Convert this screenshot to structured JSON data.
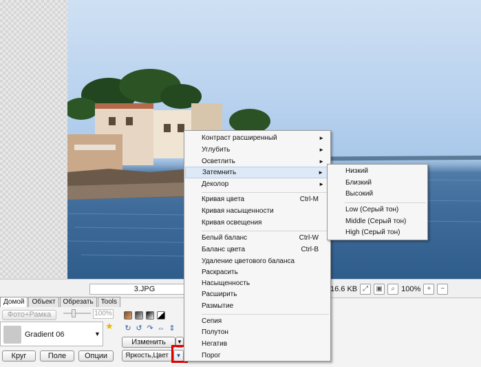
{
  "image": {
    "filename": "3.JPG"
  },
  "status": {
    "file_size": "16.6 KB",
    "zoom": "100%"
  },
  "tabs": [
    {
      "label": "Домой"
    },
    {
      "label": "Объект"
    },
    {
      "label": "Обрезать"
    },
    {
      "label": "Tools"
    }
  ],
  "toolbar": {
    "photo_frame_label": "Фото+Рамка",
    "opacity": "100%",
    "gradient_name": "Gradient 06",
    "circle_label": "Круг",
    "field_label": "Поле",
    "options_label": "Опции",
    "change_label": "Изменить",
    "brightness_label": "Яркость,Цвет"
  },
  "menu": {
    "items": [
      {
        "label": "Контраст расширенный",
        "submenu": true
      },
      {
        "label": "Углубить",
        "submenu": true
      },
      {
        "label": "Осветлить",
        "submenu": true
      },
      {
        "label": "Затемнить",
        "submenu": true,
        "highlighted": true
      },
      {
        "label": "Деколор",
        "submenu": true
      },
      {
        "label": "Кривая цвета",
        "shortcut": "Ctrl-M"
      },
      {
        "label": "Кривая насыщенности"
      },
      {
        "label": "Кривая освещения"
      },
      {
        "label": "Белый баланс",
        "shortcut": "Ctrl-W"
      },
      {
        "label": "Баланс цвета",
        "shortcut": "Ctrl-B"
      },
      {
        "label": "Удаление цветового баланса"
      },
      {
        "label": "Раскрасить"
      },
      {
        "label": "Насыщенность"
      },
      {
        "label": "Расширить"
      },
      {
        "label": "Размытие"
      },
      {
        "label": "Сепия"
      },
      {
        "label": "Полутон"
      },
      {
        "label": "Негатив"
      },
      {
        "label": "Порог"
      }
    ]
  },
  "submenu": {
    "items": [
      {
        "label": "Низкий"
      },
      {
        "label": "Близкий"
      },
      {
        "label": "Высокий"
      },
      {
        "label": "Low (Серый тон)"
      },
      {
        "label": "Middle (Серый тон)"
      },
      {
        "label": "High (Серый тон)"
      }
    ]
  }
}
